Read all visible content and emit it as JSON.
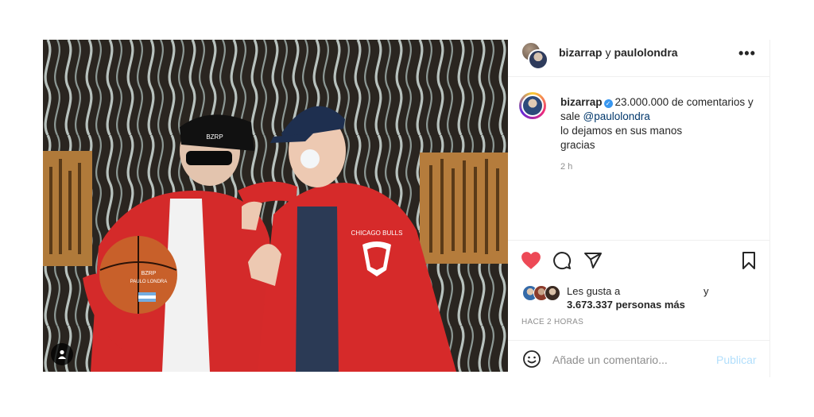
{
  "header": {
    "user1": "bizarrap",
    "connector": "y",
    "user2": "paulolondra",
    "more_icon": "more-horizontal-icon"
  },
  "caption": {
    "username": "bizarrap",
    "verified_icon": "verified-badge-icon",
    "text_line1": "23.000.000 de comentarios y",
    "text_line2_prefix": "sale",
    "mention": "@paulolondra",
    "text_line3": "lo dejamos en sus manos",
    "text_line4": "gracias",
    "time": "2 h"
  },
  "image": {
    "cap1_text": "BZRP",
    "shirt_text": "CHICAGO BULLS",
    "ball_text1": "BZRP",
    "ball_text2": "PAULO LONDRA"
  },
  "actions": {
    "like_icon": "heart-icon",
    "comment_icon": "comment-icon",
    "share_icon": "share-icon",
    "save_icon": "bookmark-icon",
    "liked": true,
    "like_color": "#ed4956"
  },
  "likes": {
    "prefix": "Les gusta a",
    "connector": "y",
    "count_text": "3.673.337 personas más"
  },
  "post_time": "HACE 2 HORAS",
  "comment": {
    "emoji_icon": "emoji-icon",
    "placeholder": "Añade un comentario...",
    "publish_label": "Publicar",
    "publish_color": "#b2dffc"
  },
  "tag_icon": "user-tag-icon"
}
